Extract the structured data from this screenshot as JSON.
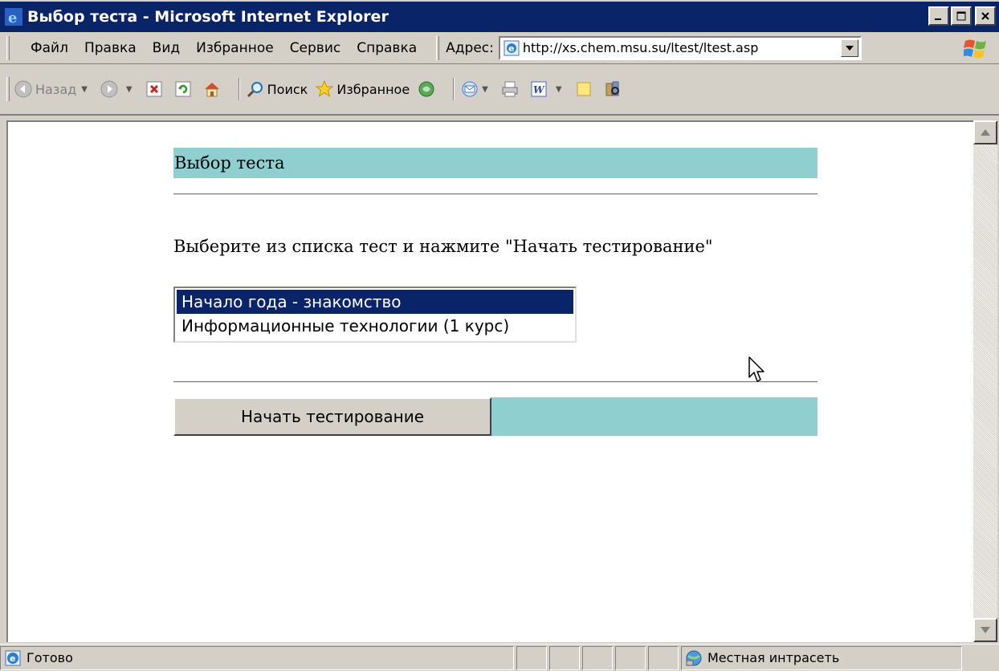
{
  "window": {
    "title": "Выбор теста - Microsoft Internet Explorer",
    "controls": [
      "minimize",
      "maximize",
      "close"
    ]
  },
  "menu": {
    "items": [
      "Файл",
      "Правка",
      "Вид",
      "Избранное",
      "Сервис",
      "Справка"
    ]
  },
  "address": {
    "label": "Адрес:",
    "url": "http://xs.chem.msu.su/ltest/ltest.asp"
  },
  "toolbar": {
    "back_label": "Назад",
    "search_label": "Поиск",
    "favorites_label": "Избранное"
  },
  "page": {
    "header": "Выбор теста",
    "instruction": "Выберите из списка тест и нажмите \"Начать тестирование\"",
    "tests": [
      {
        "label": "Начало года - знакомство",
        "selected": true
      },
      {
        "label": "Информационные технологии (1 курс)",
        "selected": false
      }
    ],
    "start_button": "Начать тестирование"
  },
  "statusbar": {
    "status": "Готово",
    "zone": "Местная интрасеть"
  },
  "colors": {
    "title_bar": "#0a246a",
    "teal_bar": "#8fcfcf",
    "selection": "#0a246a"
  }
}
